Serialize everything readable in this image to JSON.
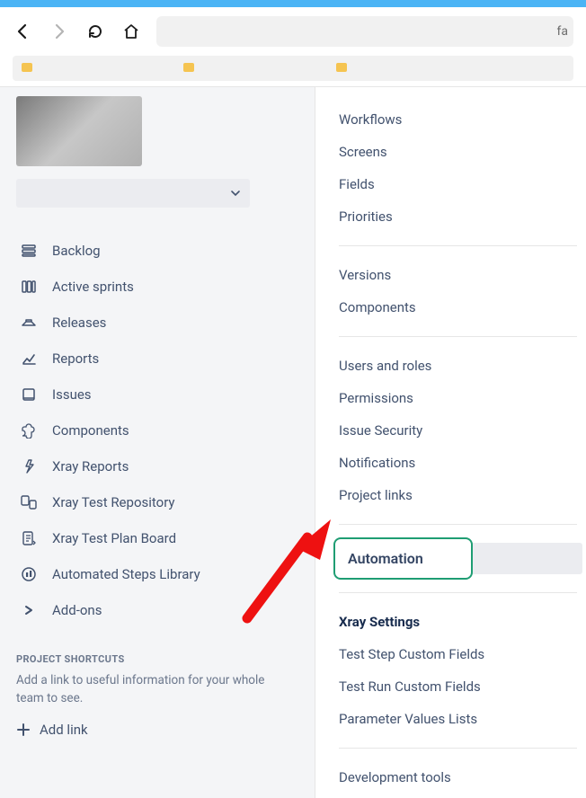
{
  "browser": {
    "url_tail": "fa"
  },
  "sidebar": {
    "board_selector_placeholder": "",
    "items": [
      {
        "label": "Backlog",
        "icon": "backlog-icon"
      },
      {
        "label": "Active sprints",
        "icon": "sprints-icon"
      },
      {
        "label": "Releases",
        "icon": "releases-icon"
      },
      {
        "label": "Reports",
        "icon": "reports-icon"
      },
      {
        "label": "Issues",
        "icon": "issues-icon"
      },
      {
        "label": "Components",
        "icon": "components-icon"
      },
      {
        "label": "Xray Reports",
        "icon": "xray-reports-icon"
      },
      {
        "label": "Xray Test Repository",
        "icon": "xray-repo-icon"
      },
      {
        "label": "Xray Test Plan Board",
        "icon": "xray-plan-icon"
      },
      {
        "label": "Automated Steps Library",
        "icon": "auto-steps-icon"
      },
      {
        "label": "Add-ons",
        "icon": "addons-icon"
      }
    ],
    "shortcuts_heading": "PROJECT SHORTCUTS",
    "shortcuts_description": "Add a link to useful information for your whole team to see.",
    "add_link_label": "Add link"
  },
  "settings": {
    "group1": [
      "Workflows",
      "Screens",
      "Fields",
      "Priorities"
    ],
    "group2": [
      "Versions",
      "Components"
    ],
    "group3": [
      "Users and roles",
      "Permissions",
      "Issue Security",
      "Notifications",
      "Project links"
    ],
    "automation": "Automation",
    "xray_heading": "Xray Settings",
    "xray_items": [
      "Test Step Custom Fields",
      "Test Run Custom Fields",
      "Parameter Values Lists"
    ],
    "dev_tools": "Development tools"
  }
}
